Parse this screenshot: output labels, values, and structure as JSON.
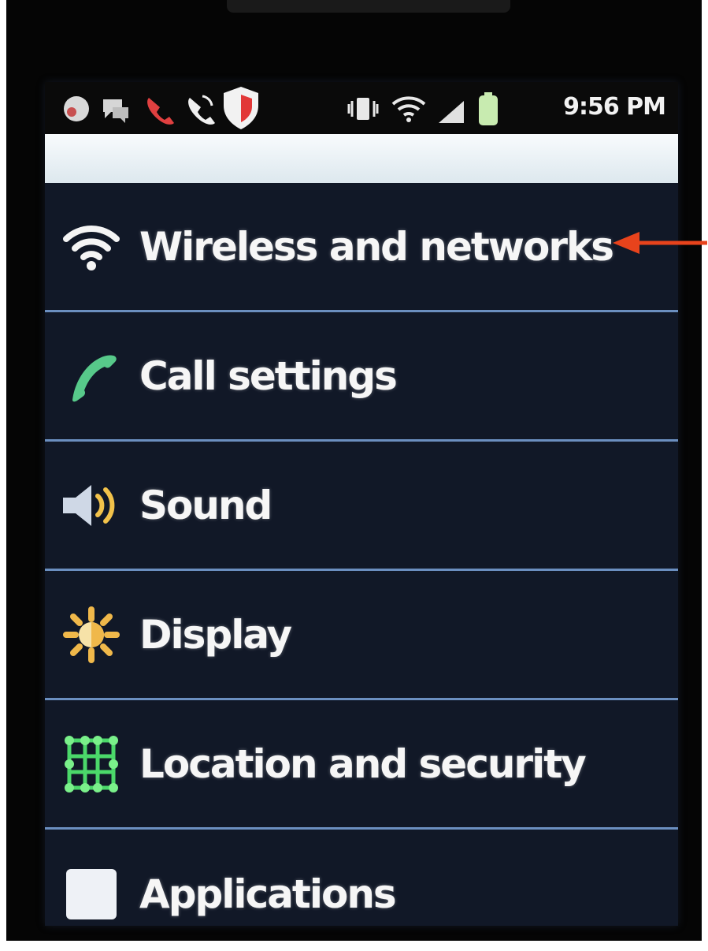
{
  "status_bar": {
    "time": "9:56 PM"
  },
  "settings": {
    "items": [
      {
        "label": "Wireless and networks",
        "icon": "wifi-icon"
      },
      {
        "label": "Call settings",
        "icon": "phone-icon"
      },
      {
        "label": "Sound",
        "icon": "speaker-icon"
      },
      {
        "label": "Display",
        "icon": "brightness-icon"
      },
      {
        "label": "Location and security",
        "icon": "location-grid-icon"
      },
      {
        "label": "Applications",
        "icon": "applications-icon"
      }
    ]
  },
  "annotation": {
    "arrow_color": "#e8431c",
    "points_to": "Wireless and networks"
  },
  "colors": {
    "divider": "#6b8fc0",
    "call_icon": "#57c98a",
    "display_icon": "#f0b84a",
    "location_icon": "#4bd86a"
  }
}
